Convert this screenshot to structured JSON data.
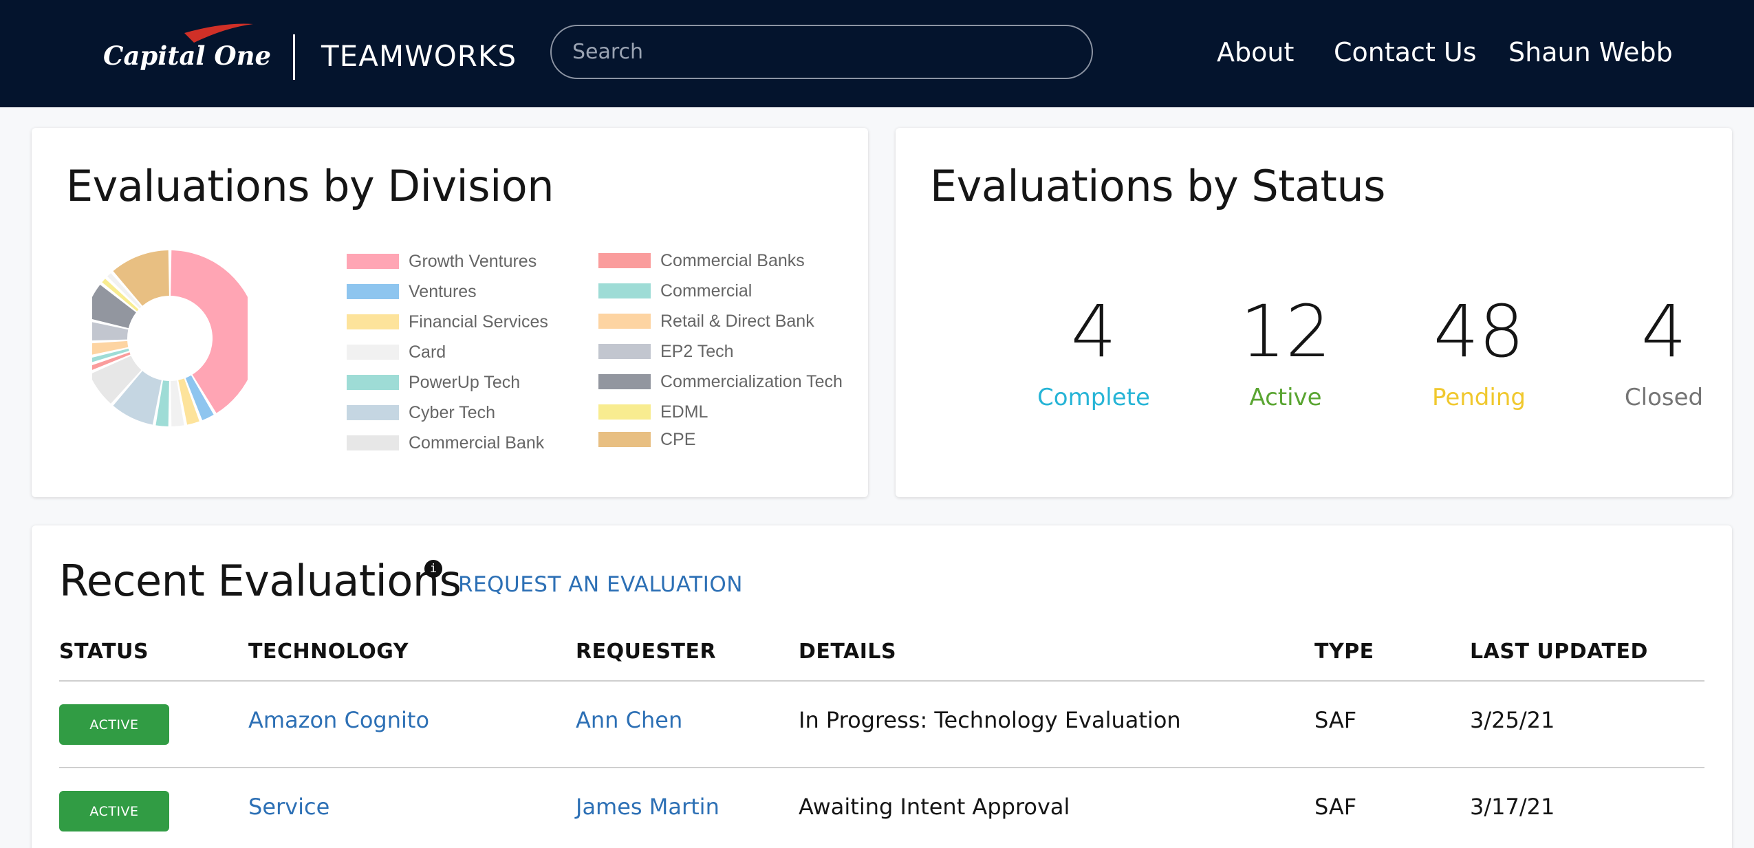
{
  "header": {
    "logo_text": "Capital One",
    "app_name": "TEAMWORKS",
    "search_placeholder": "Search",
    "nav": {
      "about": "About",
      "contact": "Contact Us",
      "user": "Shaun Webb"
    }
  },
  "division_card": {
    "title": "Evaluations by Division",
    "legend": [
      {
        "label": "Growth Ventures",
        "color": "#ffa5b4"
      },
      {
        "label": "Ventures",
        "color": "#8ec5ef"
      },
      {
        "label": "Financial Services",
        "color": "#fde39b"
      },
      {
        "label": "Card",
        "color": "#f1f1f1"
      },
      {
        "label": "PowerUp Tech",
        "color": "#9edcd6"
      },
      {
        "label": "Cyber Tech",
        "color": "#c5d6e2"
      },
      {
        "label": "Commercial Bank",
        "color": "#e7e7e7"
      },
      {
        "label": "Commercial Banks",
        "color": "#fa9c9c"
      },
      {
        "label": "Commercial",
        "color": "#9edcd6"
      },
      {
        "label": "Retail & Direct Bank",
        "color": "#fdd4a2"
      },
      {
        "label": "EP2 Tech",
        "color": "#c2c6cf"
      },
      {
        "label": "Commercialization Tech",
        "color": "#92969f"
      },
      {
        "label": "EDML",
        "color": "#f8ec90"
      },
      {
        "label": "CPE",
        "color": "#e8bf82"
      }
    ],
    "chart_data": {
      "type": "pie",
      "donut": true,
      "categories": [
        "Growth Ventures",
        "Ventures",
        "Financial Services",
        "Card",
        "PowerUp Tech",
        "Cyber Tech",
        "Commercial Bank",
        "Commercial Banks",
        "Commercial",
        "Retail & Direct Bank",
        "EP2 Tech",
        "Commercialization Tech",
        "EDML",
        "CPE"
      ],
      "values": [
        29,
        2,
        2,
        2,
        2,
        6,
        5,
        1,
        1,
        2,
        3,
        5,
        1,
        8
      ],
      "order": [
        "Growth Ventures",
        "Ventures",
        "Financial Services",
        "Card",
        "PowerUp Tech",
        "Cyber Tech",
        "Commercial Bank",
        "Commercial Banks",
        "Commercial",
        "Retail & Direct Bank",
        "EP2 Tech",
        "Commercialization Tech",
        "EDML",
        "Card",
        "CPE"
      ],
      "ordered_values": [
        29,
        2,
        2,
        2,
        2,
        6,
        5,
        1,
        1,
        2,
        3,
        5,
        1,
        1,
        8
      ],
      "legend_position": "right"
    }
  },
  "status_card": {
    "title": "Evaluations by Status",
    "stats": [
      {
        "value": "4",
        "label": "Complete",
        "color": "#26b4d6"
      },
      {
        "value": "12",
        "label": "Active",
        "color": "#5aa532"
      },
      {
        "value": "48",
        "label": "Pending",
        "color": "#f0c82e"
      },
      {
        "value": "4",
        "label": "Closed",
        "color": "#757575"
      }
    ]
  },
  "recent": {
    "title": "Recent Evaluations",
    "info_icon": "i",
    "request_link": "REQUEST AN EVALUATION",
    "columns": [
      "STATUS",
      "TECHNOLOGY",
      "REQUESTER",
      "DETAILS",
      "TYPE",
      "LAST UPDATED"
    ],
    "rows": [
      {
        "status": "ACTIVE",
        "technology": "Amazon Cognito",
        "requester": "Ann Chen",
        "details": "In Progress: Technology Evaluation",
        "type": "SAF",
        "updated": "3/25/21"
      },
      {
        "status": "ACTIVE",
        "technology": "Service",
        "requester": "James Martin",
        "details": "Awaiting Intent Approval",
        "type": "SAF",
        "updated": "3/17/21"
      }
    ]
  }
}
